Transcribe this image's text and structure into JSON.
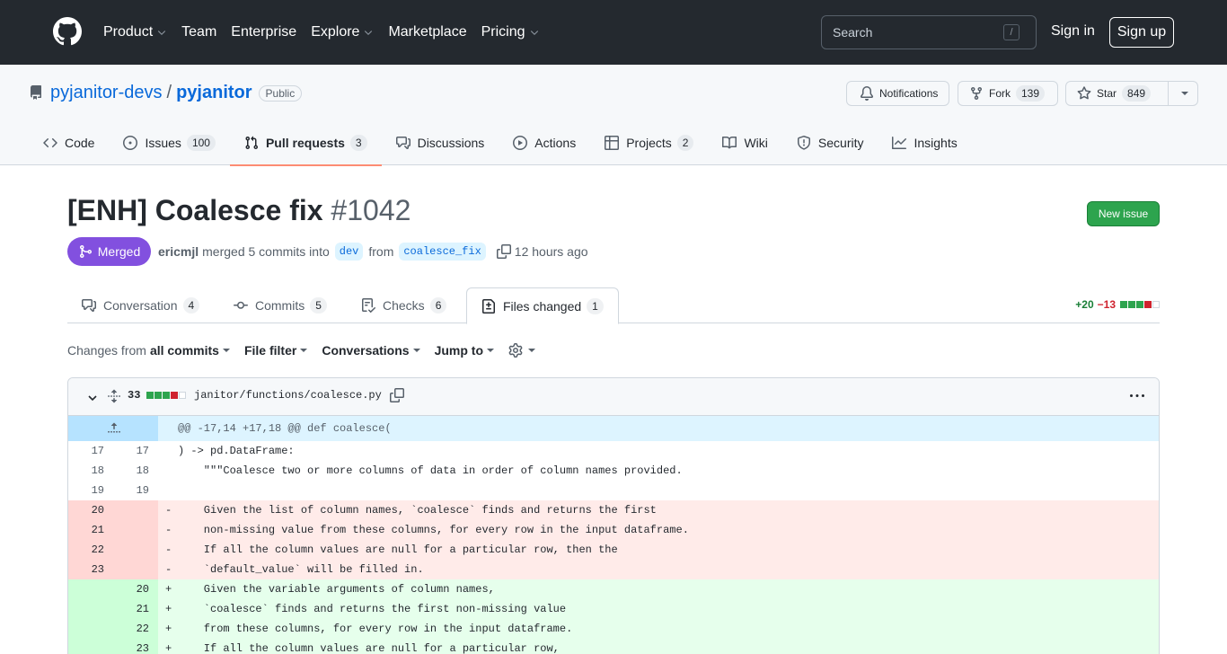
{
  "header": {
    "nav": [
      {
        "label": "Product",
        "caret": true
      },
      {
        "label": "Team",
        "caret": false
      },
      {
        "label": "Enterprise",
        "caret": false
      },
      {
        "label": "Explore",
        "caret": true
      },
      {
        "label": "Marketplace",
        "caret": false
      },
      {
        "label": "Pricing",
        "caret": true
      }
    ],
    "search_placeholder": "Search",
    "search_key": "/",
    "sign_in": "Sign in",
    "sign_up": "Sign up"
  },
  "repo": {
    "owner": "pyjanitor-devs",
    "separator": "/",
    "name": "pyjanitor",
    "visibility": "Public",
    "notifications_label": "Notifications",
    "fork_label": "Fork",
    "fork_count": "139",
    "star_label": "Star",
    "star_count": "849"
  },
  "repo_tabs": [
    {
      "label": "Code",
      "icon": "code-icon",
      "count": ""
    },
    {
      "label": "Issues",
      "icon": "issue-icon",
      "count": "100"
    },
    {
      "label": "Pull requests",
      "icon": "pull-request-icon",
      "count": "3",
      "selected": true
    },
    {
      "label": "Discussions",
      "icon": "discussions-icon",
      "count": ""
    },
    {
      "label": "Actions",
      "icon": "play-icon",
      "count": ""
    },
    {
      "label": "Projects",
      "icon": "table-icon",
      "count": "2"
    },
    {
      "label": "Wiki",
      "icon": "book-icon",
      "count": ""
    },
    {
      "label": "Security",
      "icon": "shield-icon",
      "count": ""
    },
    {
      "label": "Insights",
      "icon": "graph-icon",
      "count": ""
    }
  ],
  "pr": {
    "title": "[ENH] Coalesce fix",
    "number": "#1042",
    "new_issue": "New issue",
    "state": "Merged",
    "author": "ericmjl",
    "merged_text": "merged 5 commits into",
    "base_branch": "dev",
    "from_text": "from",
    "head_branch": "coalesce_fix",
    "time": "12 hours ago"
  },
  "pr_tabs": [
    {
      "label": "Conversation",
      "count": "4"
    },
    {
      "label": "Commits",
      "count": "5"
    },
    {
      "label": "Checks",
      "count": "6"
    },
    {
      "label": "Files changed",
      "count": "1"
    }
  ],
  "diffstat": {
    "additions": "+20",
    "deletions": "−13"
  },
  "toolbar": {
    "changes_from": "Changes from",
    "all_commits": "all commits",
    "file_filter": "File filter",
    "conversations": "Conversations",
    "jump_to": "Jump to"
  },
  "file": {
    "changes": "33",
    "path": "janitor/functions/coalesce.py",
    "hunk": "@@ -17,14 +17,18 @@ def coalesce(",
    "lines": [
      {
        "type": "ctx",
        "old": "17",
        "new": "17",
        "marker": "",
        "text": ") -> pd.DataFrame:"
      },
      {
        "type": "ctx",
        "old": "18",
        "new": "18",
        "marker": "",
        "text": "    \"\"\"Coalesce two or more columns of data in order of column names provided."
      },
      {
        "type": "ctx",
        "old": "19",
        "new": "19",
        "marker": "",
        "text": ""
      },
      {
        "type": "del",
        "old": "20",
        "new": "",
        "marker": "-",
        "text": "    Given the list of column names, `coalesce` finds and returns the first"
      },
      {
        "type": "del",
        "old": "21",
        "new": "",
        "marker": "-",
        "text": "    non-missing value from these columns, for every row in the input dataframe."
      },
      {
        "type": "del",
        "old": "22",
        "new": "",
        "marker": "-",
        "text": "    If all the column values are null for a particular row, then the"
      },
      {
        "type": "del",
        "old": "23",
        "new": "",
        "marker": "-",
        "text": "    `default_value` will be filled in."
      },
      {
        "type": "add",
        "old": "",
        "new": "20",
        "marker": "+",
        "text": "    Given the variable arguments of column names,"
      },
      {
        "type": "add",
        "old": "",
        "new": "21",
        "marker": "+",
        "text": "    `coalesce` finds and returns the first non-missing value"
      },
      {
        "type": "add",
        "old": "",
        "new": "22",
        "marker": "+",
        "text": "    from these columns, for every row in the input dataframe."
      },
      {
        "type": "add",
        "old": "",
        "new": "23",
        "marker": "+",
        "text": "    If all the column values are null for a particular row,"
      }
    ]
  },
  "colors": {
    "header_bg": "#24292f",
    "link": "#0969da",
    "merged": "#8250df",
    "primary_button": "#2da44e",
    "addition": "#1a7f37",
    "deletion": "#cf222e"
  }
}
